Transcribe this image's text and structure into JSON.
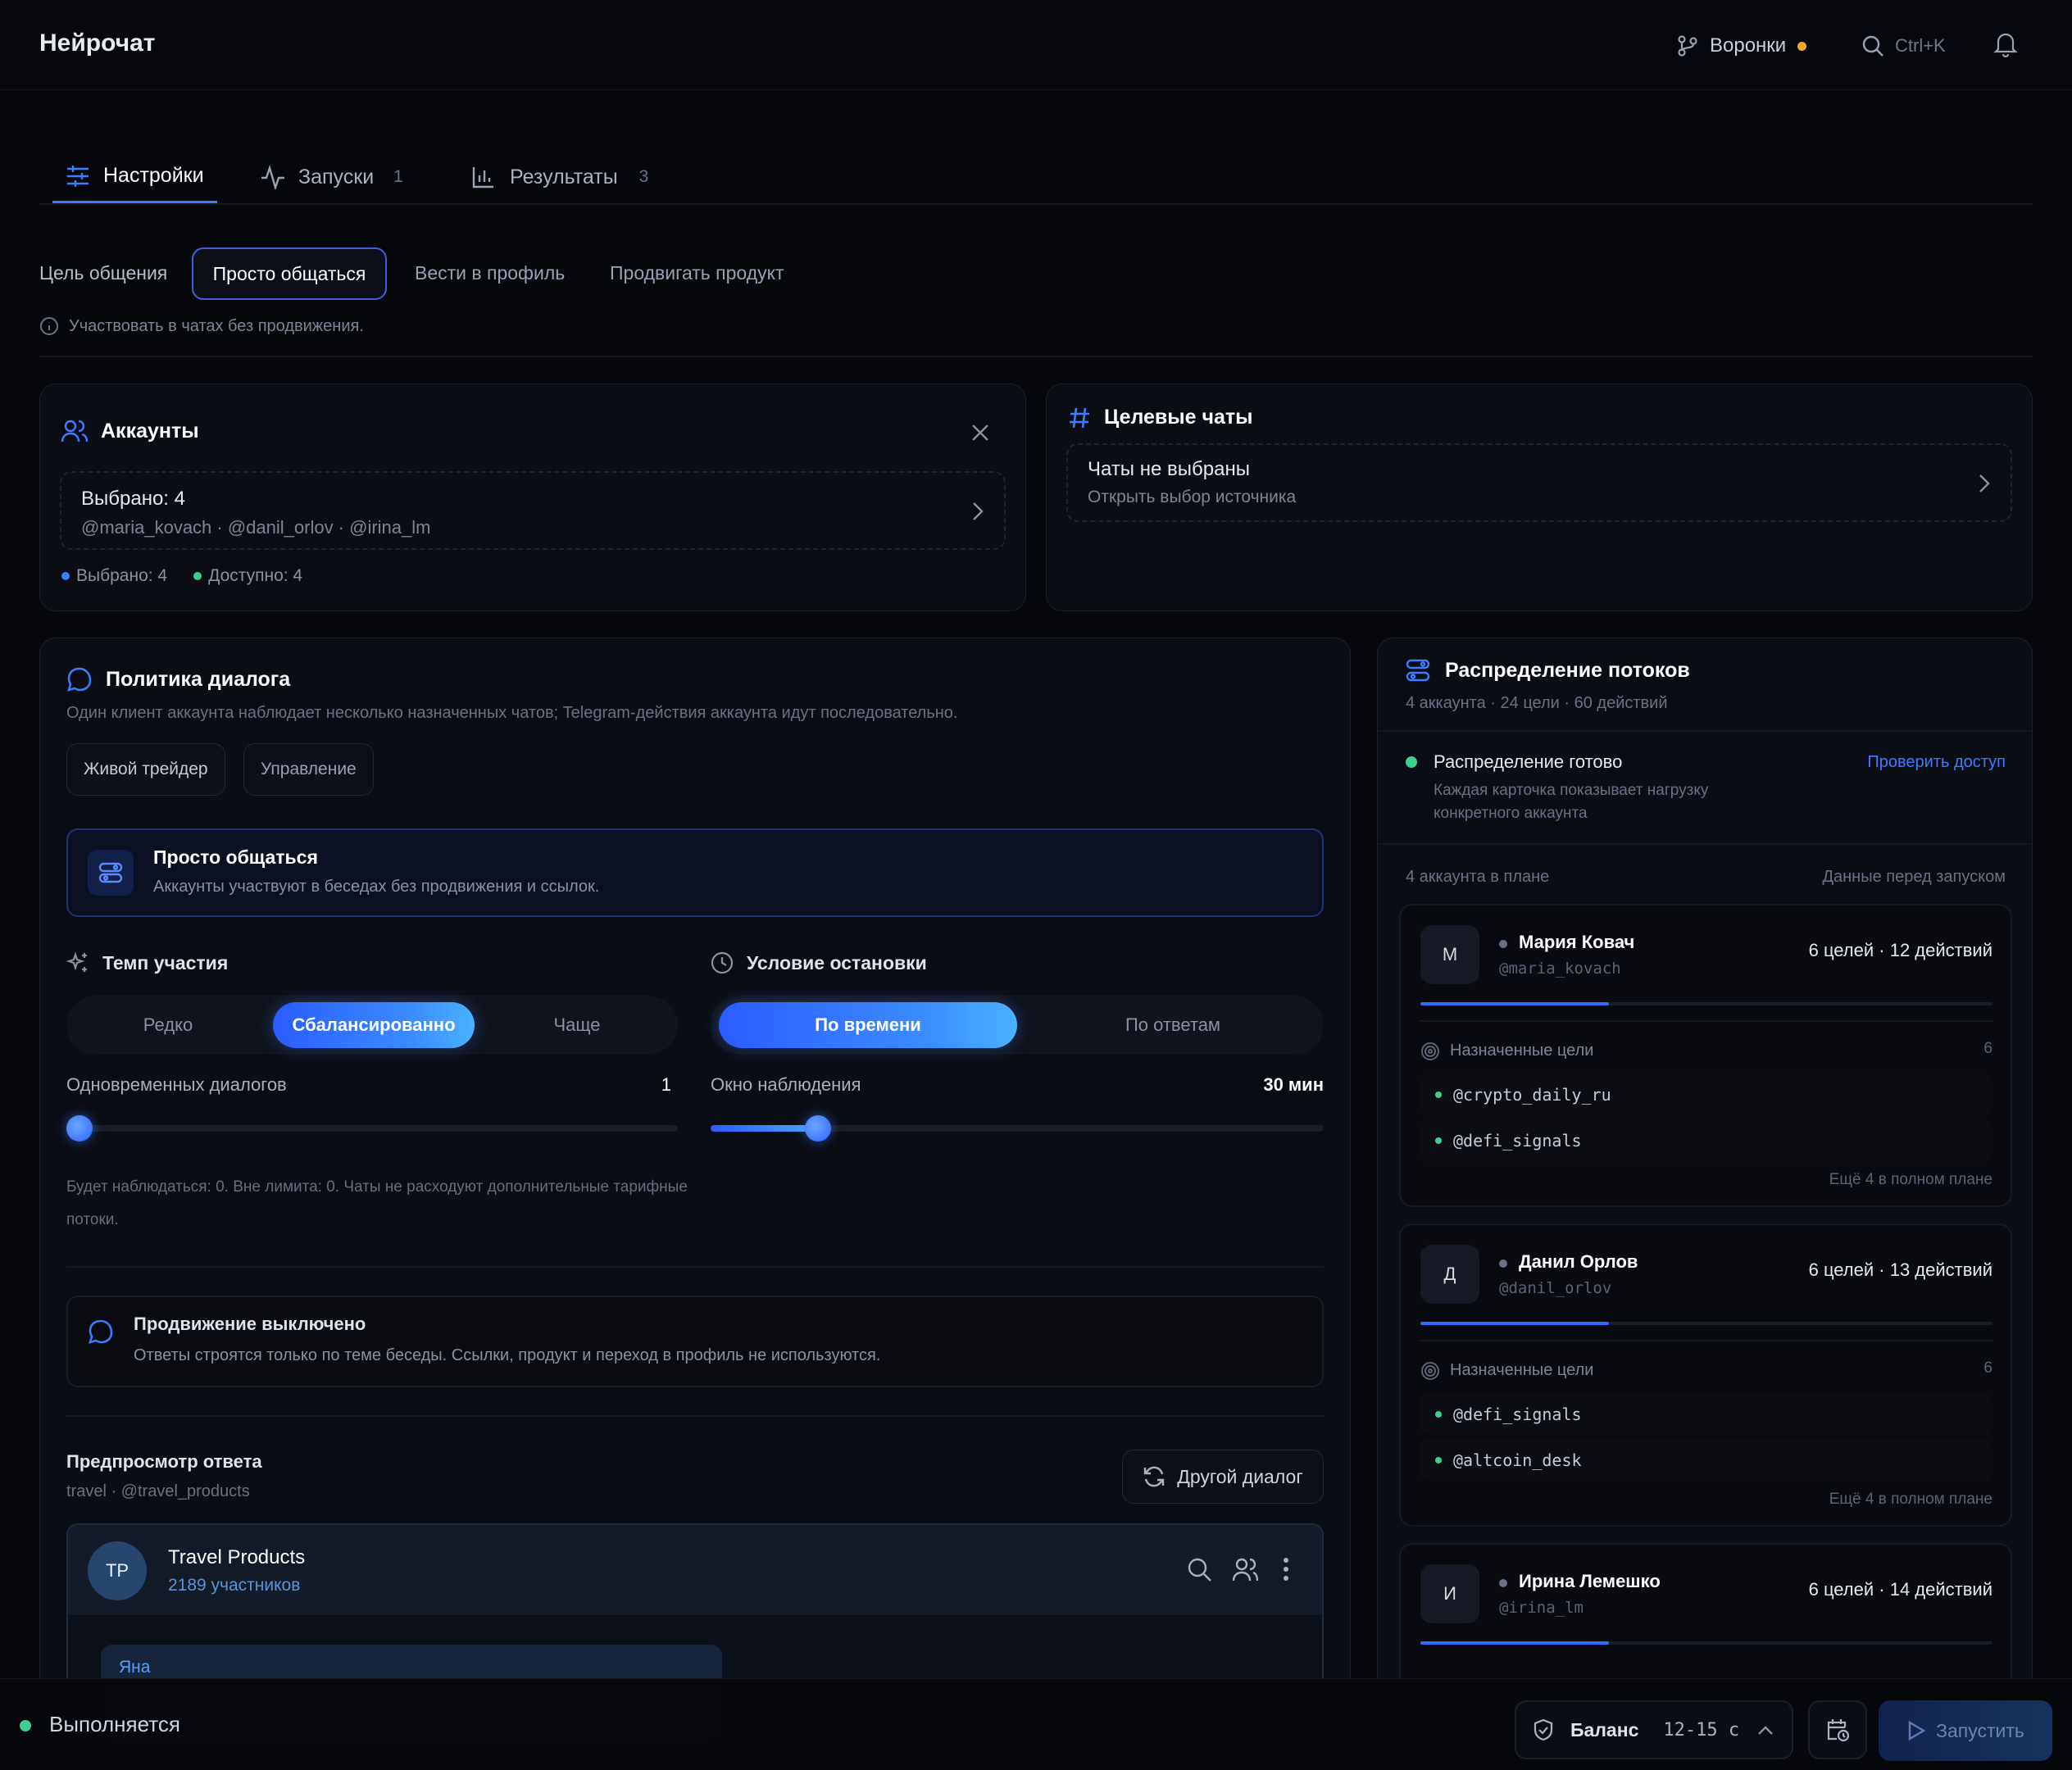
{
  "app": {
    "title": "Нейрочат"
  },
  "header": {
    "funnels_label": "Воронки",
    "search_shortcut": "Ctrl+K"
  },
  "tabs": [
    {
      "label": "Настройки",
      "count": ""
    },
    {
      "label": "Запуски",
      "count": "1"
    },
    {
      "label": "Результаты",
      "count": "3"
    }
  ],
  "goal": {
    "label": "Цель общения",
    "options": [
      "Просто общаться",
      "Вести в профиль",
      "Продвигать продукт"
    ],
    "hint": "Участвовать в чатах без продвижения."
  },
  "accounts": {
    "title": "Аккаунты",
    "selected_line": "Выбрано: 4",
    "handles": "@maria_kovach · @danil_orlov · @irina_lm",
    "stat_selected": "Выбрано: 4",
    "stat_available": "Доступно: 4"
  },
  "target_chats": {
    "title": "Целевые чаты",
    "empty": "Чаты не выбраны",
    "open_source": "Открыть выбор источника"
  },
  "policy": {
    "title": "Политика диалога",
    "subtitle": "Один клиент аккаунта наблюдает несколько назначенных чатов; Telegram-действия аккаунта идут последовательно.",
    "chips": [
      "Живой трейдер",
      "Управление"
    ],
    "mode_title": "Просто общаться",
    "mode_desc": "Аккаунты участвуют в беседах без продвижения и ссылок.",
    "pace_title": "Темп участия",
    "pace_options": [
      "Редко",
      "Сбалансированно",
      "Чаще"
    ],
    "stop_title": "Условие остановки",
    "stop_options": [
      "По времени",
      "По ответам"
    ],
    "concurrent_label": "Одновременных диалогов",
    "concurrent_value": "1",
    "concurrent_level": 0,
    "window_label": "Окно наблюдения",
    "window_value": "30 мин",
    "window_level": 0.16,
    "note": "Будет наблюдаться: 0. Вне лимита: 0. Чаты не расходуют дополнительные тарифные потоки.",
    "promo_title": "Продвижение выключено",
    "promo_desc": "Ответы строятся только по теме беседы. Ссылки, продукт и переход в профиль не используются.",
    "preview_title": "Предпросмотр ответа",
    "preview_source": "travel · @travel_products",
    "other_dialog": "Другой диалог",
    "chat_avatar": "TP",
    "chat_name": "Travel Products",
    "chat_members": "2189 участников",
    "message_author": "Яна"
  },
  "distribution": {
    "title": "Распределение потоков",
    "summary": "4 аккаунта · 24 цели · 60 действий",
    "status_title": "Распределение готово",
    "status_desc": "Каждая карточка показывает нагрузку конкретного аккаунта",
    "check_access": "Проверить доступ",
    "plan_left": "4 аккаунта в плане",
    "plan_right": "Данные перед запуском",
    "accounts": [
      {
        "initial": "М",
        "name": "Мария Ковач",
        "handle": "@maria_kovach",
        "load": "6 целей · 12 действий",
        "load_level": 0.33,
        "targets_label": "Назначенные цели",
        "targets_count": "6",
        "targets": [
          "@crypto_daily_ru",
          "@defi_signals"
        ],
        "more": "Ещё 4 в полном плане"
      },
      {
        "initial": "Д",
        "name": "Данил Орлов",
        "handle": "@danil_orlov",
        "load": "6 целей · 13 действий",
        "load_level": 0.33,
        "targets_label": "Назначенные цели",
        "targets_count": "6",
        "targets": [
          "@defi_signals",
          "@altcoin_desk"
        ],
        "more": "Ещё 4 в полном плане"
      },
      {
        "initial": "И",
        "name": "Ирина Лемешко",
        "handle": "@irina_lm",
        "load": "6 целей · 14 действий",
        "load_level": 0.33
      }
    ]
  },
  "footer": {
    "status": "Выполняется",
    "balance_label": "Баланс",
    "balance_value": "12-15 с",
    "run_label": "Запустить"
  },
  "colors": {
    "accent": "#3d7bff",
    "success": "#3ecf8e",
    "warning": "#f5a623",
    "background": "#06070b"
  }
}
